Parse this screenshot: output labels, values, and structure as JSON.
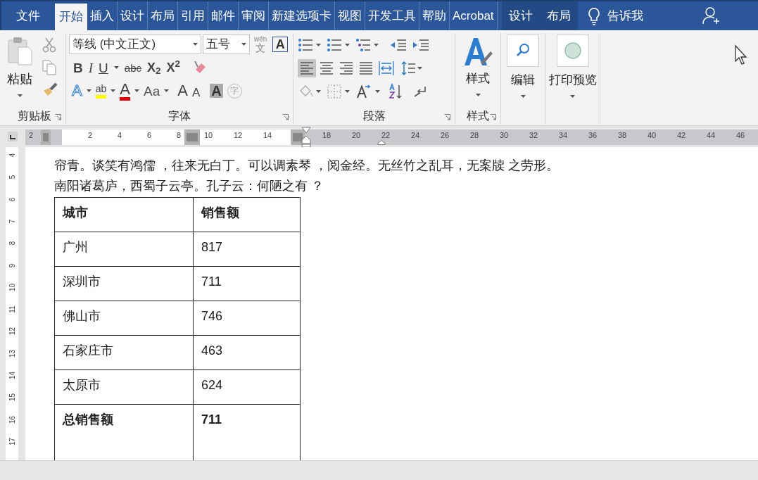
{
  "tabs": [
    {
      "label": "文件",
      "selected": false,
      "kind": "file"
    },
    {
      "label": "开始",
      "selected": true,
      "kind": "normal"
    },
    {
      "label": "插入",
      "selected": false,
      "kind": "normal"
    },
    {
      "label": "设计",
      "selected": false,
      "kind": "normal"
    },
    {
      "label": "布局",
      "selected": false,
      "kind": "normal"
    },
    {
      "label": "引用",
      "selected": false,
      "kind": "normal"
    },
    {
      "label": "邮件",
      "selected": false,
      "kind": "normal"
    },
    {
      "label": "审阅",
      "selected": false,
      "kind": "normal"
    },
    {
      "label": "新建选项卡",
      "selected": false,
      "kind": "normal"
    },
    {
      "label": "视图",
      "selected": false,
      "kind": "normal"
    },
    {
      "label": "开发工具",
      "selected": false,
      "kind": "normal"
    },
    {
      "label": "帮助",
      "selected": false,
      "kind": "normal"
    },
    {
      "label": "Acrobat",
      "selected": false,
      "kind": "normal"
    },
    {
      "label": "设计",
      "selected": false,
      "kind": "contextual"
    },
    {
      "label": "布局",
      "selected": false,
      "kind": "contextual"
    }
  ],
  "tell_me": "告诉我",
  "ribbon": {
    "clipboard": {
      "paste": "粘贴",
      "label": "剪贴板"
    },
    "font": {
      "font_name": "等线 (中文正文)",
      "font_size": "五号",
      "phonetic": "wén",
      "phonetic_char": "文",
      "border_char": "A",
      "row2": [
        "B",
        "I",
        "U",
        "abc",
        "X$_{2}$",
        "X$^{2}$"
      ],
      "row3": [
        {
          "text": "A",
          "kind": "effect"
        },
        {
          "text": "ab",
          "kind": "highlight"
        },
        {
          "text": "A",
          "kind": "color"
        },
        {
          "text": "Aa",
          "kind": "case"
        },
        {
          "text": "A",
          "kind": "grow"
        },
        {
          "text": "A",
          "kind": "shrink"
        },
        {
          "text": "A",
          "kind": "shade"
        },
        {
          "text": "字",
          "kind": "circle"
        }
      ],
      "label": "字体"
    },
    "paragraph": {
      "alignment": [
        {
          "kind": "left",
          "selected": true
        },
        {
          "kind": "center",
          "selected": false
        },
        {
          "kind": "right",
          "selected": false
        },
        {
          "kind": "justify",
          "selected": false
        }
      ],
      "label": "段落"
    },
    "styles": {
      "button": "样式",
      "label": "样式"
    },
    "editing": {
      "button": "编辑"
    },
    "print_preview": {
      "button": "打印预览"
    }
  },
  "ruler": {
    "horizontal": [
      "2",
      "2",
      "4",
      "6",
      "8",
      "10",
      "12",
      "14",
      "18",
      "20",
      "22",
      "24",
      "26",
      "28",
      "30",
      "32",
      "34",
      "36",
      "38",
      "40",
      "42",
      "44",
      "46"
    ],
    "vertical": [
      "4",
      "5",
      "6",
      "7",
      "8",
      "9",
      "10",
      "11",
      "12",
      "13",
      "14",
      "15",
      "16",
      "17"
    ]
  },
  "document": {
    "lines": [
      "帘青。谈笑有鸿儒 ，往来无白丁。可以调素琴 ，阅金经。无丝竹之乱耳，无案牍 之劳形。",
      "南阳诸葛庐，西蜀子云亭。孔子云：何陋之有 ？"
    ],
    "table": {
      "rows": [
        {
          "cells": [
            "城市",
            "销售额"
          ],
          "bold": true
        },
        {
          "cells": [
            "广州",
            "817"
          ],
          "bold": false
        },
        {
          "cells": [
            "深圳市",
            "711"
          ],
          "bold": false
        },
        {
          "cells": [
            "佛山市",
            "746"
          ],
          "bold": false
        },
        {
          "cells": [
            "石家庄市",
            "463"
          ],
          "bold": false
        },
        {
          "cells": [
            "太原市",
            "624"
          ],
          "bold": false
        },
        {
          "cells": [
            "总销售额",
            "711"
          ],
          "bold": true
        }
      ]
    }
  }
}
